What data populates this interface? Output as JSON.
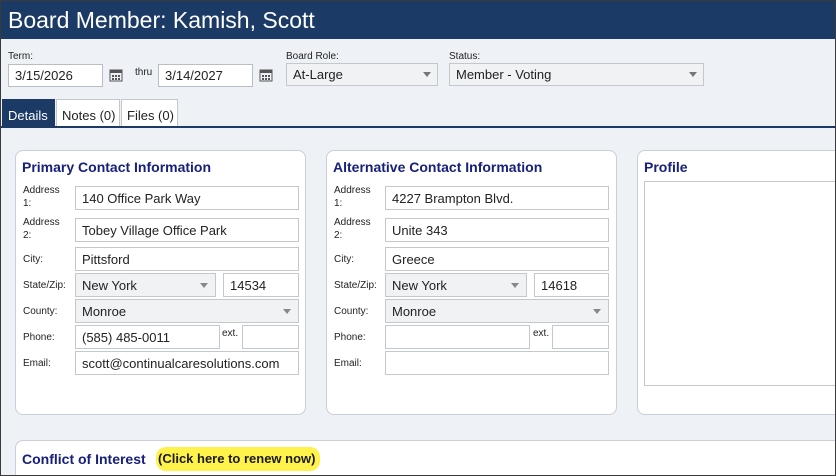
{
  "header": {
    "title": "Board Member: Kamish, Scott"
  },
  "term": {
    "label": "Term:",
    "start": "3/15/2026",
    "thru_label": "thru",
    "end": "3/14/2027"
  },
  "board_role": {
    "label": "Board Role:",
    "value": "At-Large"
  },
  "status": {
    "label": "Status:",
    "value": "Member - Voting"
  },
  "tabs": [
    {
      "label": "Details",
      "active": true
    },
    {
      "label": "Notes (0)",
      "active": false
    },
    {
      "label": "Files (0)",
      "active": false
    }
  ],
  "labels": {
    "address1": "Address 1:",
    "address2": "Address 2:",
    "city": "City:",
    "state_zip": "State/Zip:",
    "county": "County:",
    "phone": "Phone:",
    "ext": "ext.",
    "email": "Email:"
  },
  "primary": {
    "title": "Primary Contact Information",
    "address1": "140 Office Park Way",
    "address2": "Tobey Village Office Park",
    "city": "Pittsford",
    "state": "New York",
    "zip": "14534",
    "county": "Monroe",
    "phone": "(585) 485-0011",
    "ext": "",
    "email": "scott@continualcaresolutions.com"
  },
  "alternative": {
    "title": "Alternative Contact Information",
    "address1": "4227 Brampton Blvd.",
    "address2": "Unite 343",
    "city": "Greece",
    "state": "New York",
    "zip": "14618",
    "county": "Monroe",
    "phone": "",
    "ext": "",
    "email": ""
  },
  "profile": {
    "title": "Profile",
    "text": ""
  },
  "conflict": {
    "title": "Conflict of Interest",
    "renew_link": "(Click here to renew now)"
  },
  "colors": {
    "header_bg": "#1b3a66",
    "section_title": "#17207a",
    "highlight": "#fff24a"
  }
}
